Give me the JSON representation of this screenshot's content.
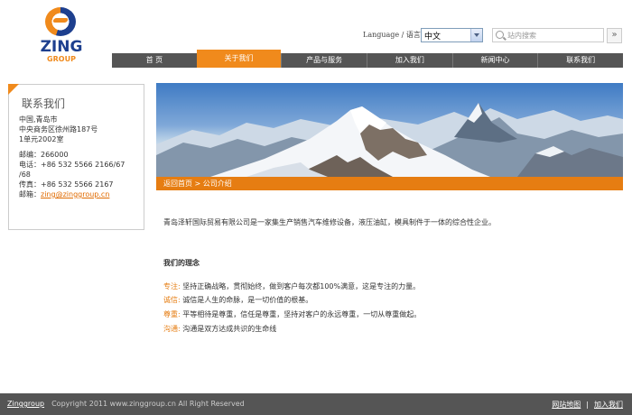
{
  "logo": {
    "brand": "ZING",
    "sub": "GROUP"
  },
  "header": {
    "language_label": "Language / 语言",
    "language_selected": "中文",
    "search_placeholder": "站内搜索",
    "search_go": "»"
  },
  "nav": {
    "items": [
      {
        "label": "首 页",
        "active": false
      },
      {
        "label": "关于我们",
        "active": true
      },
      {
        "label": "产品与服务",
        "active": false
      },
      {
        "label": "加入我们",
        "active": false
      },
      {
        "label": "新闻中心",
        "active": false
      },
      {
        "label": "联系我们",
        "active": false
      }
    ]
  },
  "sidebar": {
    "title": "联系我们",
    "address": [
      "中国,青岛市",
      "中央商务区徐州路187号",
      "1单元2002室"
    ],
    "postcode": "邮编：266000",
    "phone_line1": "电话：+86 532 5566 2166/67",
    "phone_line2": "/68",
    "fax": "传真：+86 532 5566 2167",
    "email_label": "邮箱：",
    "email": "zing@zinggroup.cn"
  },
  "breadcrumb": "返回首页 > 公司介绍",
  "content": {
    "intro": "青岛泽轩国际贸易有限公司是一家集生产销售汽车维修设备，液压油缸，模具制件于一体的综合性企业。",
    "heading": "我们的理念",
    "values": [
      {
        "key": "专注:",
        "text": " 坚持正确战略，贯彻始终，做到客户每次都100%满意，这是专注的力量。"
      },
      {
        "key": "诚信:",
        "text": " 诚信是人生的命脉，是一切价值的根基。"
      },
      {
        "key": "尊重:",
        "text": " 平等相待是尊重，信任是尊重，坚持对客户的永远尊重，一切从尊重做起。"
      },
      {
        "key": "沟通:",
        "text": " 沟通是双方达成共识的生命线"
      }
    ]
  },
  "footer": {
    "brand": "Zinggroup",
    "copyright": "Copyright 2011  www.zinggroup.cn All Right Reserved",
    "links": [
      "网站地图",
      "加入我们"
    ]
  }
}
